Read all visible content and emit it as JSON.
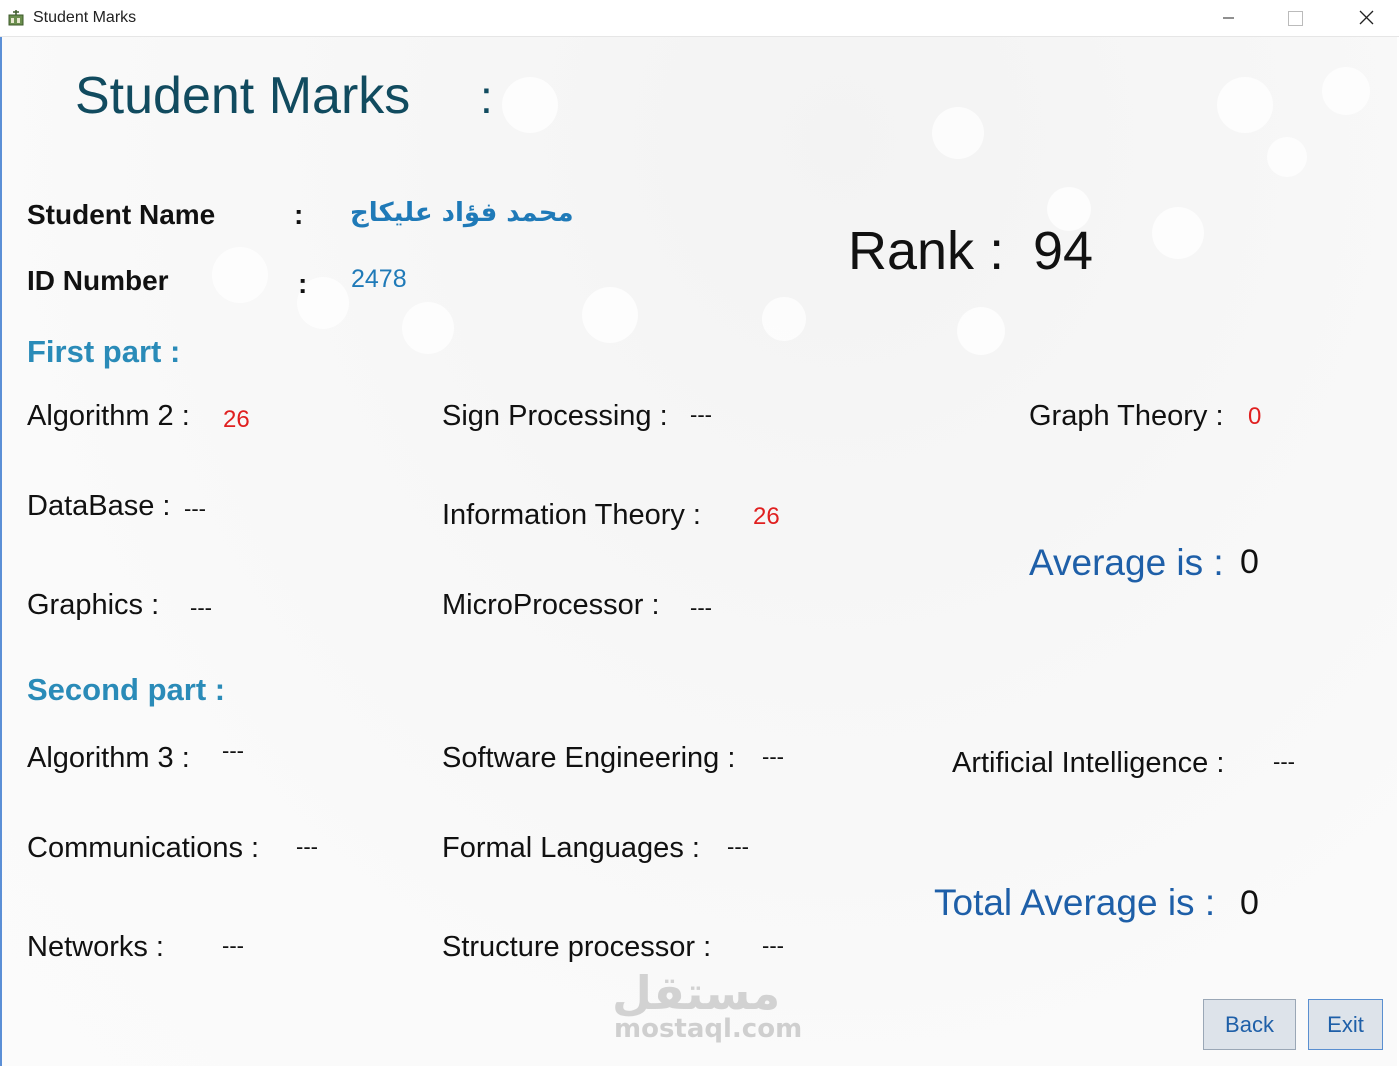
{
  "window": {
    "title": "Student Marks"
  },
  "header": {
    "title": "Student Marks",
    "colon": ":"
  },
  "student": {
    "name_label": "Student Name",
    "name_colon": ":",
    "name_value": "محمد فؤاد عليكاج",
    "id_label": "ID Number",
    "id_colon": ":",
    "id_value": "2478"
  },
  "rank": {
    "label": "Rank :",
    "value": "94"
  },
  "first_part": {
    "title": "First part :",
    "subjects": [
      {
        "label": "Algorithm 2 :",
        "mark": "26"
      },
      {
        "label": "Sign Processing :",
        "mark": "---"
      },
      {
        "label": "Graph Theory :",
        "mark": "0"
      },
      {
        "label": "DataBase :",
        "mark": "---"
      },
      {
        "label": "Information Theory :",
        "mark": "26"
      },
      {
        "label": "Graphics :",
        "mark": "---"
      },
      {
        "label": "MicroProcessor :",
        "mark": "---"
      }
    ],
    "average_label": "Average is :",
    "average_value": "0"
  },
  "second_part": {
    "title": "Second part :",
    "subjects": [
      {
        "label": "Algorithm 3 :",
        "mark": "---"
      },
      {
        "label": "Software Engineering :",
        "mark": "---"
      },
      {
        "label": "Artificial Intelligence :",
        "mark": "---"
      },
      {
        "label": "Communications :",
        "mark": "---"
      },
      {
        "label": "Formal Languages :",
        "mark": "---"
      },
      {
        "label": "Networks :",
        "mark": "---"
      },
      {
        "label": "Structure processor :",
        "mark": "---"
      }
    ],
    "total_average_label": "Total Average is :",
    "total_average_value": "0"
  },
  "buttons": {
    "back": "Back",
    "exit": "Exit"
  },
  "watermark": {
    "arabic": "مستقل",
    "latin": "mostaql.com"
  },
  "colors": {
    "accent_blue": "#1e5fa8",
    "section_blue": "#2a8bb8",
    "mark_red": "#e02020",
    "title_teal": "#114b5f"
  }
}
